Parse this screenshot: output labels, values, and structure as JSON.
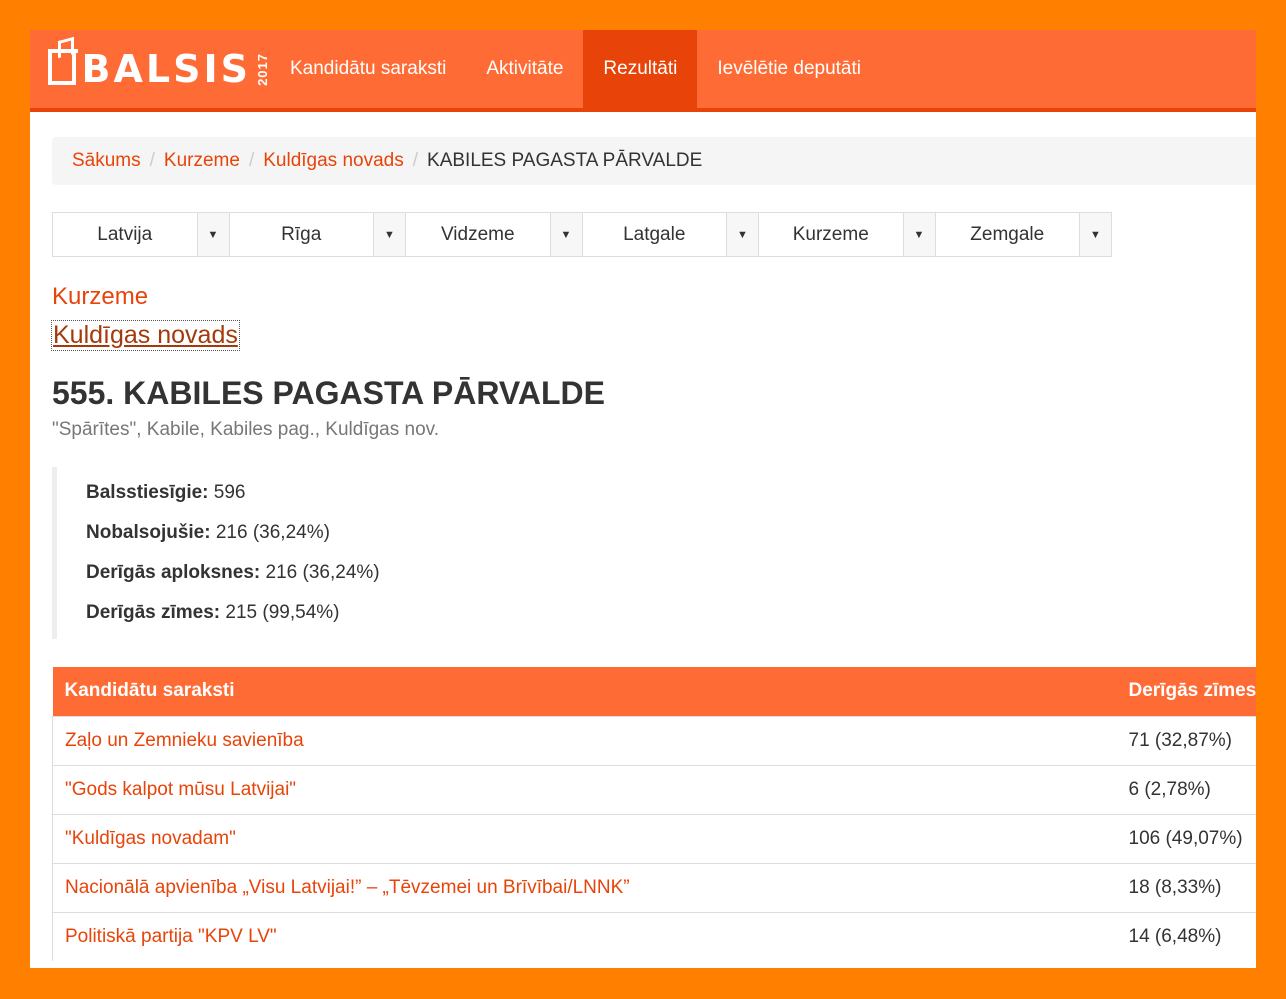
{
  "brand": {
    "word": "BALSIS",
    "year": "2017"
  },
  "nav": [
    {
      "label": "Kandidātu saraksti",
      "active": false
    },
    {
      "label": "Aktivitāte",
      "active": false
    },
    {
      "label": "Rezultāti",
      "active": true
    },
    {
      "label": "Ievēlētie deputāti",
      "active": false
    }
  ],
  "breadcrumb": {
    "items": [
      "Sākums",
      "Kurzeme",
      "Kuldīgas novads"
    ],
    "current": "KABILES PAGASTA PĀRVALDE",
    "separator": "/"
  },
  "selectors": [
    "Latvija",
    "Rīga",
    "Vidzeme",
    "Latgale",
    "Kurzeme",
    "Zemgale"
  ],
  "region": "Kurzeme",
  "district": "Kuldīgas novads",
  "station": {
    "title": "555. KABILES PAGASTA PĀRVALDE",
    "address": "\"Spārītes\", Kabile, Kabiles pag., Kuldīgas nov."
  },
  "stats": [
    {
      "label": "Balsstiesīgie:",
      "value": "596"
    },
    {
      "label": "Nobalsojušie:",
      "value": "216 (36,24%)"
    },
    {
      "label": "Derīgās aploksnes:",
      "value": "216 (36,24%)"
    },
    {
      "label": "Derīgās zīmes:",
      "value": "215 (99,54%)"
    }
  ],
  "table": {
    "headers": [
      "Kandidātu saraksti",
      "Derīgās zīmes"
    ],
    "rows": [
      {
        "party": "Zaļo un Zemnieku savienība",
        "votes": "71 (32,87%)"
      },
      {
        "party": "\"Gods kalpot mūsu Latvijai\"",
        "votes": "6 (2,78%)"
      },
      {
        "party": "\"Kuldīgas novadam\"",
        "votes": "106 (49,07%)"
      },
      {
        "party": "Nacionālā apvienība „Visu Latvijai!” – „Tēvzemei un Brīvībai/LNNK”",
        "votes": "18 (8,33%)"
      },
      {
        "party": "Politiskā partija \"KPV LV\"",
        "votes": "14 (6,48%)"
      }
    ]
  },
  "colors": {
    "frame": "#ff7f00",
    "navbar": "#ff6b35",
    "accent": "#e8440a"
  }
}
